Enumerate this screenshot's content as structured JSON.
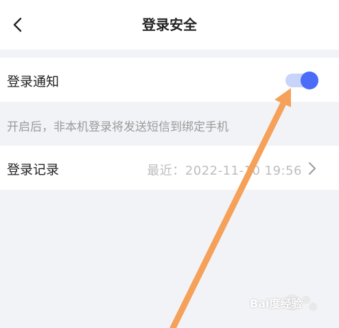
{
  "header": {
    "title": "登录安全",
    "back_icon": "chevron-left-icon"
  },
  "login_notify": {
    "label": "登录通知",
    "enabled": true,
    "accent": "#4a6cf7",
    "track": "#c9d4fb"
  },
  "hint": "开启后，非本机登录将发送短信到绑定手机",
  "login_record": {
    "label": "登录记录",
    "value": "最近：2022-11-10 19:56",
    "chevron_icon": "chevron-right-icon"
  },
  "overlay": {
    "arrow_color": "#f5a15a",
    "watermark": "Bai度经验"
  }
}
